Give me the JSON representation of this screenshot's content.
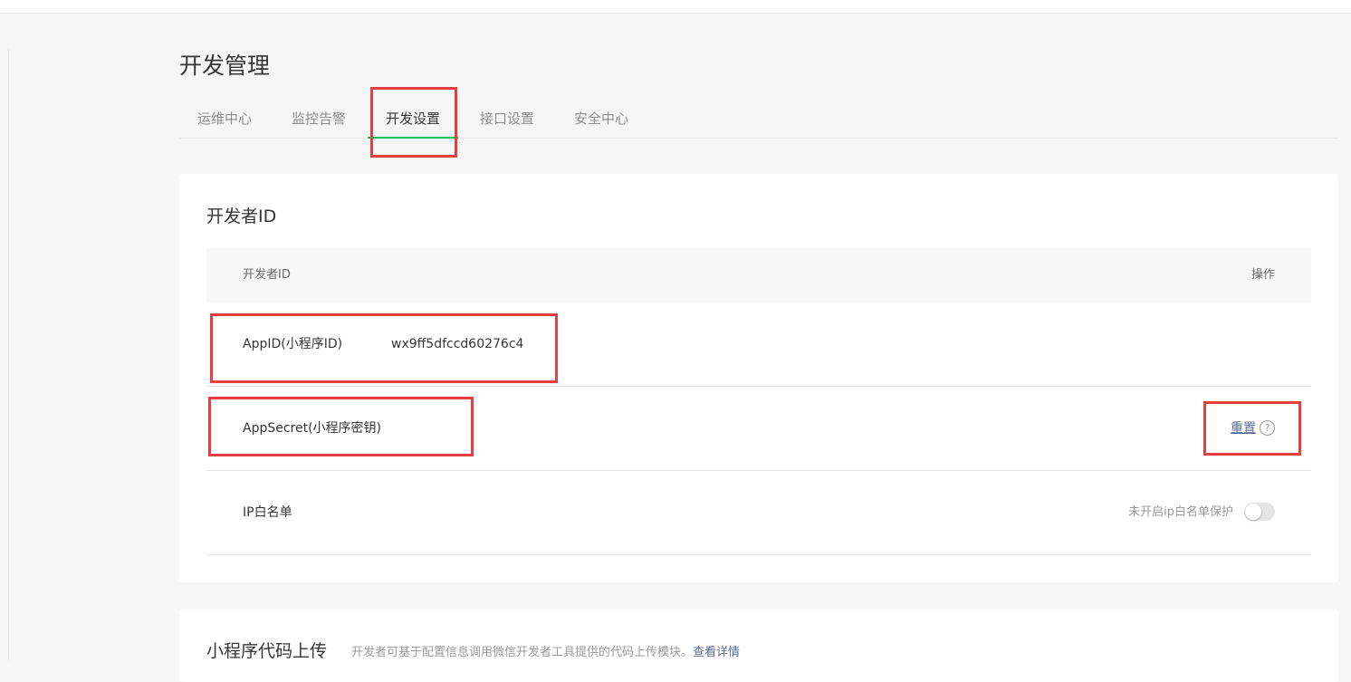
{
  "page": {
    "title": "开发管理"
  },
  "tabs": [
    {
      "label": "运维中心"
    },
    {
      "label": "监控告警"
    },
    {
      "label": "开发设置"
    },
    {
      "label": "接口设置"
    },
    {
      "label": "安全中心"
    }
  ],
  "active_tab": "开发设置",
  "developer_id": {
    "title": "开发者ID",
    "header": {
      "col1": "开发者ID",
      "col2": "操作"
    },
    "rows": {
      "appid": {
        "label": "AppID(小程序ID)",
        "value": "wx9ff5dfccd60276c4"
      },
      "secret": {
        "label": "AppSecret(小程序密钥)",
        "action": "重置",
        "help": "?"
      },
      "ip_whitelist": {
        "label": "IP白名单",
        "status": "未开启ip白名单保护",
        "enabled": false
      }
    }
  },
  "code_upload": {
    "title": "小程序代码上传",
    "description": "开发者可基于配置信息调用微信开发者工具提供的代码上传模块。",
    "more_link": "查看详情"
  },
  "colors": {
    "accent": "#07c160",
    "link": "#576b95",
    "highlight": "#e53f3f"
  }
}
